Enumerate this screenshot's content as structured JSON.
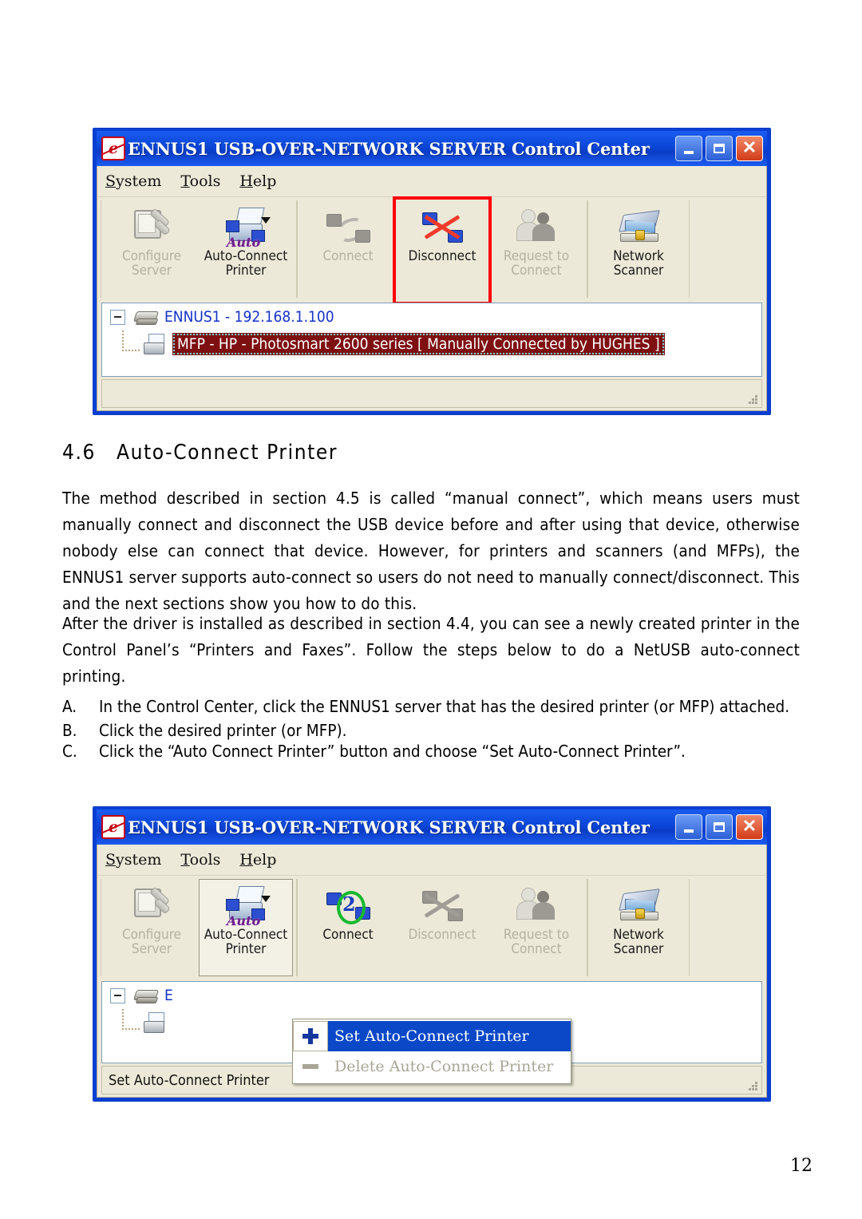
{
  "document": {
    "heading_number": "4.6",
    "heading_text": "Auto-Connect Printer",
    "paragraph_1": "The method described in section 4.5 is called “manual connect”, which means users must manually connect and disconnect the USB device before and after using that device, otherwise nobody else can connect that device. However, for printers and scanners (and MFPs), the ENNUS1 server supports auto-connect so users do not need to manually connect/disconnect. This and the next sections show you how to do this.",
    "paragraph_2": "After the driver is installed as described in section 4.4, you can see a newly created printer in the Control Panel’s “Printers and Faxes”. Follow the steps below to do a NetUSB auto-connect printing.",
    "steps": [
      {
        "marker": "A.",
        "text": "In the Control Center, click the ENNUS1 server that has the desired printer (or MFP) attached."
      },
      {
        "marker": "B.",
        "text": "Click the desired printer (or MFP)."
      },
      {
        "marker": "C.",
        "text": "Click the “Auto Connect Printer” button and choose “Set Auto-Connect Printer”."
      }
    ],
    "page_number": "12"
  },
  "window_top": {
    "title": "ENNUS1 USB-OVER-NETWORK  SERVER Control Center",
    "title_icon": "app-logo-icon",
    "window_buttons": {
      "minimize": "minimize-icon",
      "maximize": "maximize-icon",
      "close": "close-icon"
    },
    "menu": [
      {
        "label": "System",
        "mnemonic": "S"
      },
      {
        "label": "Tools",
        "mnemonic": "T"
      },
      {
        "label": "Help",
        "mnemonic": "H"
      }
    ],
    "toolbar": [
      {
        "label": "Configure\nServer",
        "icon": "configure-server-icon",
        "enabled": false,
        "pressed": false,
        "highlighted": false
      },
      {
        "label": "Auto-Connect\nPrinter",
        "icon": "auto-connect-printer-icon",
        "enabled": true,
        "pressed": false,
        "highlighted": false,
        "has_dropdown": true
      },
      {
        "label": "Connect",
        "icon": "connect-icon",
        "enabled": false,
        "pressed": false,
        "highlighted": false
      },
      {
        "label": "Disconnect",
        "icon": "disconnect-icon",
        "enabled": true,
        "pressed": false,
        "highlighted": true
      },
      {
        "label": "Request to\nConnect",
        "icon": "request-to-connect-icon",
        "enabled": false,
        "pressed": false,
        "highlighted": false
      },
      {
        "label": "Network\nScanner",
        "icon": "network-scanner-icon",
        "enabled": true,
        "pressed": false,
        "highlighted": false
      }
    ],
    "tree": {
      "server_label": "ENNUS1 - 192.168.1.100",
      "server_icon": "server-icon",
      "expander": "collapse-icon",
      "child_label": "MFP - HP - Photosmart 2600 series [ Manually Connected by HUGHES ]",
      "child_icon": "printer-icon",
      "child_selected": true
    },
    "statusbar_text": "",
    "colors": {
      "title_gradient_start": "#1b5cf0",
      "title_gradient_end": "#0a3cc6",
      "client_bg": "#ece9d8",
      "selection_bg": "#7e1012",
      "tree_link": "#1432c8",
      "annotation_red": "#ff0000"
    }
  },
  "window_bottom": {
    "title": "ENNUS1 USB-OVER-NETWORK  SERVER Control Center",
    "title_icon": "app-logo-icon",
    "window_buttons": {
      "minimize": "minimize-icon",
      "maximize": "maximize-icon",
      "close": "close-icon"
    },
    "menu": [
      {
        "label": "System",
        "mnemonic": "S"
      },
      {
        "label": "Tools",
        "mnemonic": "T"
      },
      {
        "label": "Help",
        "mnemonic": "H"
      }
    ],
    "toolbar": [
      {
        "label": "Configure\nServer",
        "icon": "configure-server-icon",
        "enabled": false,
        "pressed": false
      },
      {
        "label": "Auto-Connect\nPrinter",
        "icon": "auto-connect-printer-icon",
        "enabled": true,
        "pressed": true,
        "has_dropdown": true
      },
      {
        "label": "Connect",
        "icon": "connect-icon",
        "enabled": true,
        "pressed": false
      },
      {
        "label": "Disconnect",
        "icon": "disconnect-icon",
        "enabled": false,
        "pressed": false
      },
      {
        "label": "Request to\nConnect",
        "icon": "request-to-connect-icon",
        "enabled": false,
        "pressed": false
      },
      {
        "label": "Network\nScanner",
        "icon": "network-scanner-icon",
        "enabled": true,
        "pressed": false
      }
    ],
    "tree": {
      "server_label": "E",
      "server_icon": "server-icon",
      "expander": "collapse-icon"
    },
    "dropdown": {
      "items": [
        {
          "label": "Set Auto-Connect Printer",
          "icon": "plus-icon",
          "enabled": true,
          "selected": true
        },
        {
          "label": "Delete Auto-Connect Printer",
          "icon": "minus-icon",
          "enabled": false,
          "selected": false
        }
      ]
    },
    "statusbar_text": "Set Auto-Connect Printer"
  }
}
